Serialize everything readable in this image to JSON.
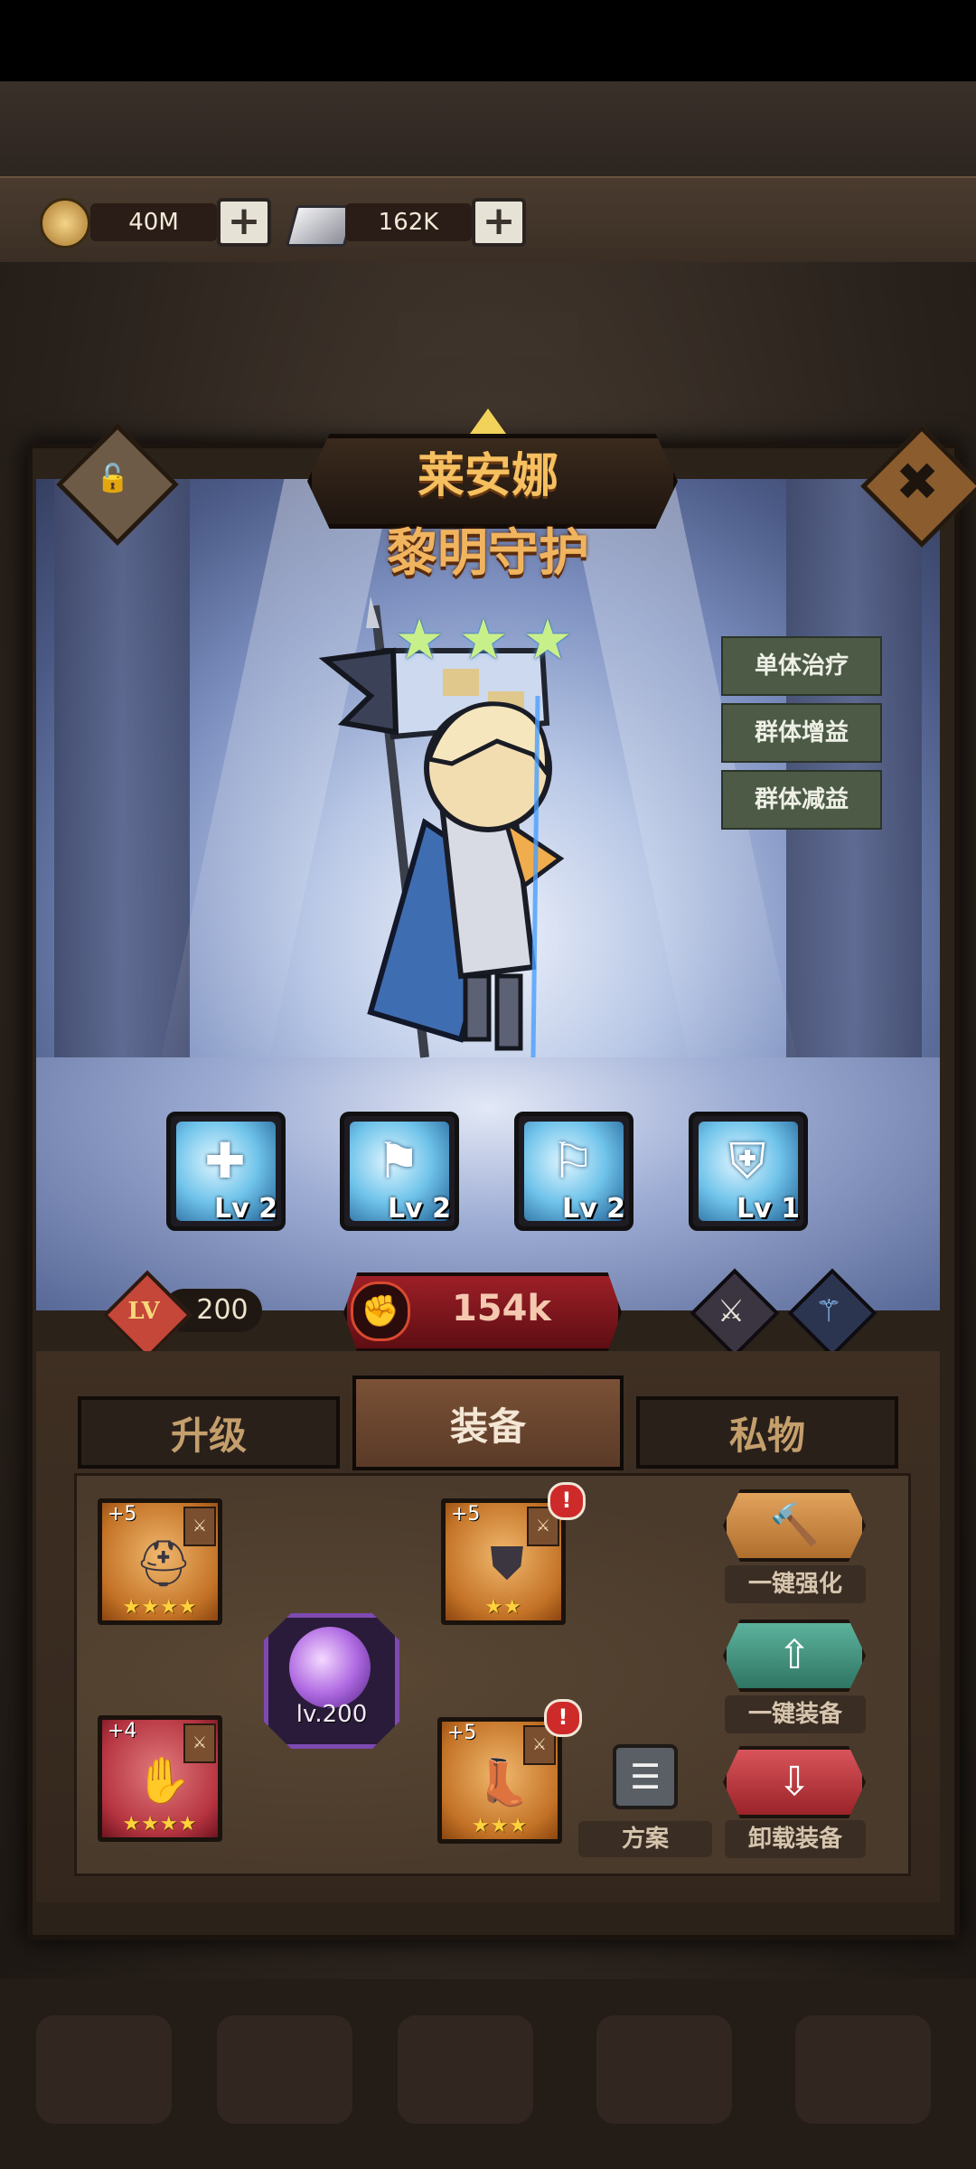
{
  "currency": {
    "gold": {
      "icon": "gold-coin-icon",
      "value": "40M"
    },
    "gem": {
      "icon": "silver-ingot-icon",
      "value": "162K"
    }
  },
  "hero": {
    "name": "莱安娜",
    "title": "黎明守护",
    "stars": 3,
    "roles": [
      "单体治疗",
      "群体增益",
      "群体减益"
    ],
    "level_label": "LV",
    "level": "200",
    "power": "154k"
  },
  "skills": [
    {
      "label": "Lv 2",
      "icon": "flag-cross-skill-icon"
    },
    {
      "label": "Lv 2",
      "icon": "flag-wind-skill-icon"
    },
    {
      "label": "Lv 2",
      "icon": "flag-wave-skill-icon"
    },
    {
      "label": "Lv 1",
      "icon": "flag-shield-skill-icon"
    }
  ],
  "tabs": [
    "升级",
    "装备",
    "私物"
  ],
  "active_tab": "装备",
  "equipment": {
    "helmet": {
      "plus": "+5",
      "stars": "★★★★",
      "rarity": "orange"
    },
    "armor": {
      "plus": "+5",
      "stars": "★★",
      "rarity": "orange",
      "alert": "!"
    },
    "gloves": {
      "plus": "+4",
      "stars": "★★★★",
      "rarity": "red"
    },
    "boots": {
      "plus": "+5",
      "stars": "★★★",
      "rarity": "orange",
      "alert": "!"
    },
    "artifact": {
      "label": "lv.200"
    }
  },
  "actions": {
    "enhance": "一键强化",
    "equip": "一键装备",
    "unequip": "卸载装备",
    "plan": "方案"
  },
  "colors": {
    "gold_text": "#f6c060",
    "power_red": "#9d1f27",
    "enhance_btn": "#c98a45",
    "equip_btn": "#3f8f7c",
    "unequip_btn": "#b9353b"
  }
}
